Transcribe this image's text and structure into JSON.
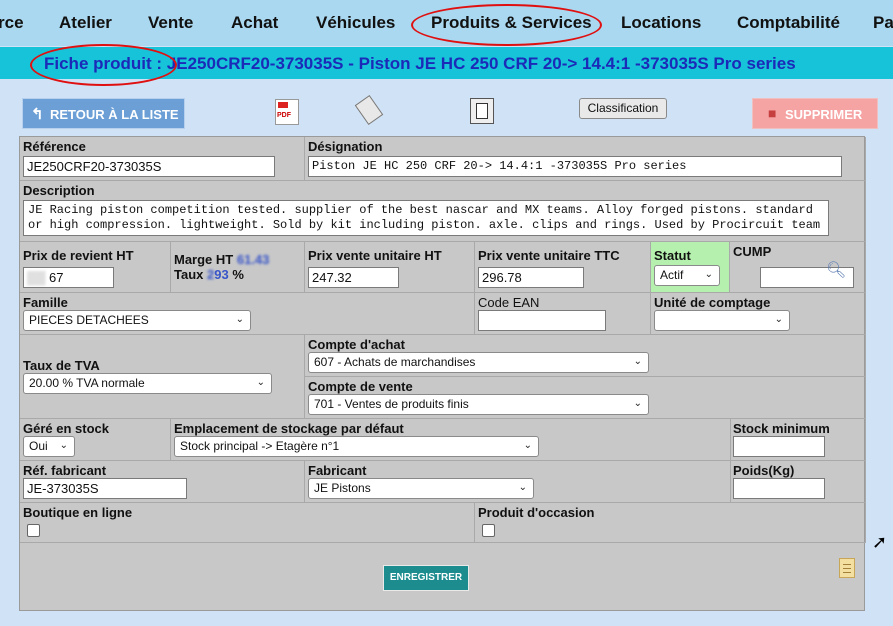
{
  "nav": {
    "items": [
      "rce",
      "Atelier",
      "Vente",
      "Achat",
      "Véhicules",
      "Produits & Services",
      "Locations",
      "Comptabilité",
      "Pa"
    ]
  },
  "banner": {
    "prefix": "Fiche produit :",
    "title": "JE250CRF20-373035S - Piston JE HC 250 CRF 20-> 14.4:1 -373035S Pro series"
  },
  "toolbar": {
    "back_label": "RETOUR À LA LISTE",
    "classification_label": "Classification",
    "delete_label": "SUPPRIMER",
    "icons": [
      "pdf-icon",
      "tag-icon",
      "duplicate-icon"
    ]
  },
  "form": {
    "reference": {
      "label": "Référence",
      "value": "JE250CRF20-373035S"
    },
    "designation": {
      "label": "Désignation",
      "value": "Piston JE HC 250 CRF 20-> 14.4:1 -373035S Pro series"
    },
    "description": {
      "label": "Description",
      "value": "JE Racing piston competition tested. supplier of the best nascar and MX teams. Alloy forged pistons. standard or high compression. lightweight. Sold by kit including piston. axle. clips and rings. Used by Procircuit team"
    },
    "prix_revient": {
      "label": "Prix de revient HT",
      "value_blurred": "",
      "value_suffix": "67"
    },
    "marge": {
      "label_ht": "Marge HT",
      "value_ht_blur": "61.43",
      "label_taux": "Taux",
      "taux_blur": "2",
      "taux_suffix": "93",
      "percent": "%"
    },
    "prix_vente_ht": {
      "label": "Prix vente unitaire HT",
      "value": "247.32"
    },
    "prix_vente_ttc": {
      "label": "Prix vente unitaire TTC",
      "value": "296.78"
    },
    "statut": {
      "label": "Statut",
      "value": "Actif"
    },
    "cump": {
      "label": "CUMP",
      "value": ""
    },
    "famille": {
      "label": "Famille",
      "value": "PIECES DETACHEES"
    },
    "code_ean": {
      "label": "Code EAN",
      "value": ""
    },
    "unite": {
      "label": "Unité de comptage",
      "value": ""
    },
    "compte_achat": {
      "label": "Compte d'achat",
      "value": "607 - Achats de marchandises"
    },
    "taux_tva": {
      "label": "Taux de TVA",
      "value": "20.00 % TVA normale"
    },
    "compte_vente": {
      "label": "Compte de vente",
      "value": "701 - Ventes de produits finis"
    },
    "gere_stock": {
      "label": "Géré en stock",
      "value": "Oui"
    },
    "emplacement": {
      "label": "Emplacement de stockage par défaut",
      "value": "Stock principal -> Etagère n°1"
    },
    "stock_min": {
      "label": "Stock minimum",
      "value": ""
    },
    "ref_fabricant": {
      "label": "Réf. fabricant",
      "value": "JE-373035S"
    },
    "fabricant": {
      "label": "Fabricant",
      "value": "JE Pistons"
    },
    "poids": {
      "label": "Poids(Kg)",
      "value": ""
    },
    "boutique": {
      "label": "Boutique en ligne"
    },
    "occasion": {
      "label": "Produit d'occasion"
    },
    "save_label": "ENREGISTRER"
  }
}
